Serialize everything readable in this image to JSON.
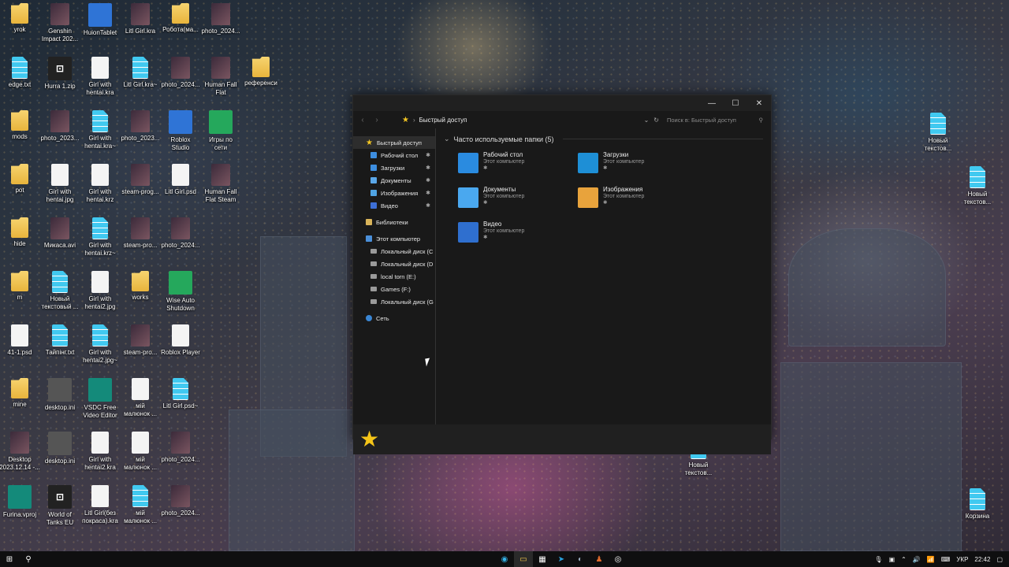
{
  "desktop": {
    "icons": [
      {
        "label": "yrok",
        "type": "folder"
      },
      {
        "label": "Genshin\nImpact 202...",
        "type": "pic"
      },
      {
        "label": "HuionTablet",
        "type": "blue"
      },
      {
        "label": "Litl Girl.kra",
        "type": "pic"
      },
      {
        "label": "Роботa(ма...",
        "type": "folder"
      },
      {
        "label": "photo_2024...",
        "type": "pic"
      },
      {
        "label": "edge.txt",
        "type": "doc"
      },
      {
        "label": "Hurra 1.zip",
        "type": "dark"
      },
      {
        "label": "Girl with\nhentai.kra",
        "type": "white"
      },
      {
        "label": "Litl Girl.kra~",
        "type": "doc"
      },
      {
        "label": "photo_2024...",
        "type": "pic"
      },
      {
        "label": "Human Fall\nFlat",
        "type": "pic"
      },
      {
        "label": "референси",
        "type": "folder"
      },
      {
        "label": "mods",
        "type": "folder"
      },
      {
        "label": "photo_2023...",
        "type": "pic"
      },
      {
        "label": "Girl with\nhentai.kra~",
        "type": "doc"
      },
      {
        "label": "photo_2023...",
        "type": "pic"
      },
      {
        "label": "Roblox\nStudio",
        "type": "blue"
      },
      {
        "label": "Игры по\nсети",
        "type": "green"
      },
      {
        "label": "pot",
        "type": "folder"
      },
      {
        "label": "Girl with\nhentai.jpg",
        "type": "white"
      },
      {
        "label": "Girl with\nhentai.krz",
        "type": "white"
      },
      {
        "label": "steam-prog...",
        "type": "pic"
      },
      {
        "label": "Litl Girl.psd",
        "type": "white"
      },
      {
        "label": "Human Fall\nFlat Steam",
        "type": "pic"
      },
      {
        "label": "hide",
        "type": "folder"
      },
      {
        "label": "Микаса.avi",
        "type": "pic"
      },
      {
        "label": "Girl with\nhentai.krz~",
        "type": "doc"
      },
      {
        "label": "steam-pro...",
        "type": "pic"
      },
      {
        "label": "photo_2024...",
        "type": "pic"
      },
      {
        "label": "m",
        "type": "folder"
      },
      {
        "label": "Новый\nтекстовый ...",
        "type": "doc"
      },
      {
        "label": "Girl with\nhentai2.jpg",
        "type": "white"
      },
      {
        "label": "works",
        "type": "folder"
      },
      {
        "label": "Wise Auto\nShutdown",
        "type": "green"
      },
      {
        "label": "41-1.psd",
        "type": "white"
      },
      {
        "label": "Тайпінг.txt",
        "type": "doc"
      },
      {
        "label": "Girl with\nhentai2.jpg~",
        "type": "doc"
      },
      {
        "label": "steam-pro...",
        "type": "pic"
      },
      {
        "label": "Roblox Player",
        "type": "white"
      },
      {
        "label": "mine",
        "type": "folder"
      },
      {
        "label": "desktop.ini",
        "type": "gray"
      },
      {
        "label": "VSDC Free\nVideo Editor",
        "type": "teal"
      },
      {
        "label": "мій\nмалюнок ...",
        "type": "white"
      },
      {
        "label": "Litl Girl.psd~",
        "type": "doc"
      },
      {
        "label": "Desktop\n2023.12.14 -...",
        "type": "pic"
      },
      {
        "label": "desktop.ini",
        "type": "gray"
      },
      {
        "label": "Girl with\nhentai2.kra",
        "type": "white"
      },
      {
        "label": "мій\nмалюнок ...",
        "type": "white"
      },
      {
        "label": "photo_2024...",
        "type": "pic"
      },
      {
        "label": "Furina.vproj",
        "type": "teal"
      },
      {
        "label": "World of\nTanks EU",
        "type": "dark"
      },
      {
        "label": "Litl Girl(без\nпокраса).kra",
        "type": "white"
      },
      {
        "label": "мій\nмалюнок ...",
        "type": "doc"
      },
      {
        "label": "photo_2024...",
        "type": "pic"
      },
      {
        "label": "Новый\nтекстов...",
        "type": "doc"
      },
      {
        "label": "Новый\nтекстов...",
        "type": "doc"
      },
      {
        "label": "Новый\nтекстов...",
        "type": "doc"
      },
      {
        "label": "Корзина",
        "type": "doc"
      }
    ]
  },
  "explorer": {
    "title_buttons": {
      "minimize": "—",
      "maximize": "☐",
      "close": "✕"
    },
    "address": {
      "separator": "›",
      "location": "Быстрый доступ"
    },
    "search_placeholder": "Поиск в: Быстрый доступ",
    "nav": {
      "quick_access": "Быстрый доступ",
      "pinned": [
        {
          "label": "Рабочий стол",
          "color": "#3d8ee0"
        },
        {
          "label": "Загрузки",
          "color": "#3d8ee0"
        },
        {
          "label": "Документы",
          "color": "#5aa7e8"
        },
        {
          "label": "Изображения",
          "color": "#4fa3e3"
        },
        {
          "label": "Видео",
          "color": "#3d6fd6"
        }
      ],
      "libraries": "Библиотеки",
      "this_pc": "Этот компьютер",
      "drives": [
        "Локальный диск (C",
        "Локальный диск (D",
        "local torn (E:)",
        "Games (F:)",
        "Локальный диск (G"
      ],
      "network": "Сеть"
    },
    "section_title": "Часто используемые папки (5)",
    "folders": [
      {
        "name": "Рабочий стол",
        "location": "Этот компьютер",
        "color": "#2a8be0"
      },
      {
        "name": "Загрузки",
        "location": "Этот компьютер",
        "color": "#1e8fd6"
      },
      {
        "name": "Документы",
        "location": "Этот компьютер",
        "color": "#4aa8ef"
      },
      {
        "name": "Изображения",
        "location": "Этот компьютер",
        "color": "#e8a33c"
      },
      {
        "name": "Видео",
        "location": "Этот компьютер",
        "color": "#2f6fcf"
      }
    ]
  },
  "taskbar": {
    "language": "УКР",
    "time": "22:42"
  }
}
